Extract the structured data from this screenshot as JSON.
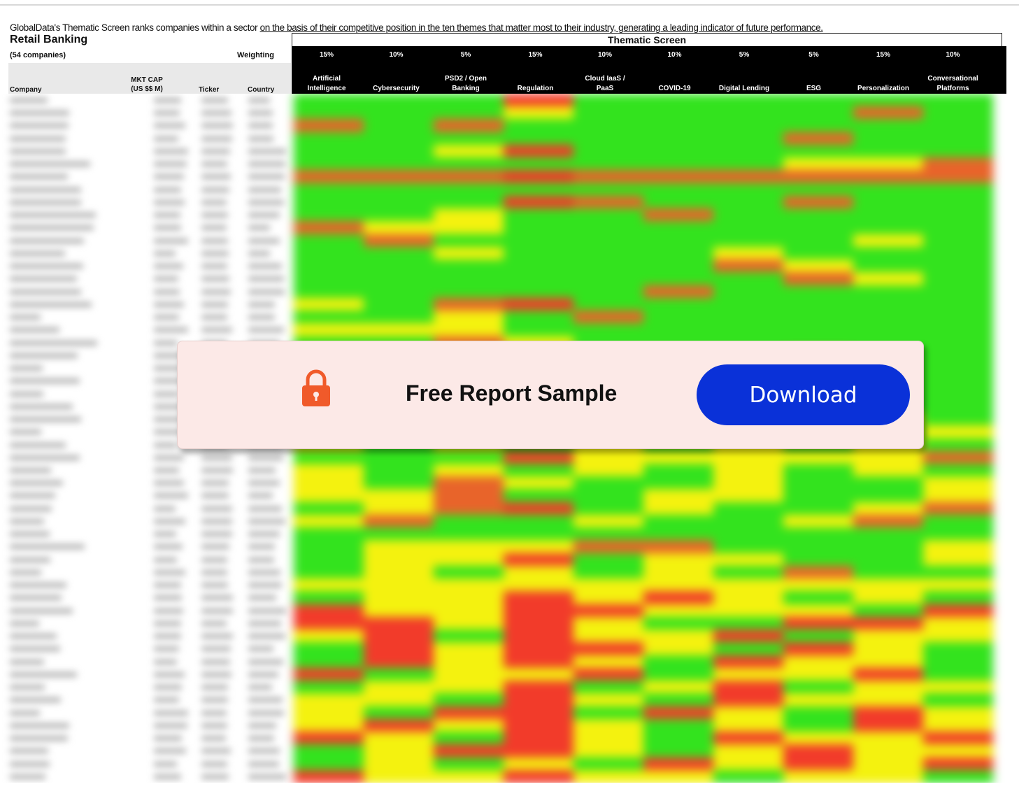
{
  "intro": {
    "text_a": "GlobalData's Thematic Screen ranks companies within a sector ",
    "text_b": "on the basis of their competitive position in the  ten themes that matter most to their industry, generating a leading indicator of future performance."
  },
  "sector_title": "Retail Banking",
  "company_count": "(54 companies)",
  "weighting_label": "Weighting",
  "screen_title": "Thematic Screen",
  "columns": {
    "company": "Company",
    "mkt_cap_1": "MKT CAP",
    "mkt_cap_2": "(US $$ M)",
    "ticker": "Ticker",
    "country": "Country"
  },
  "themes": [
    {
      "weight": "15%",
      "name_1": "Artificial",
      "name_2": "Intelligence"
    },
    {
      "weight": "10%",
      "name_1": "",
      "name_2": "Cybersecurity"
    },
    {
      "weight": "5%",
      "name_1": "PSD2 / Open",
      "name_2": "Banking"
    },
    {
      "weight": "15%",
      "name_1": "",
      "name_2": "Regulation"
    },
    {
      "weight": "10%",
      "name_1": "Cloud IaaS /",
      "name_2": "PaaS"
    },
    {
      "weight": "10%",
      "name_1": "",
      "name_2": "COVID-19"
    },
    {
      "weight": "5%",
      "name_1": "",
      "name_2": "Digital Lending"
    },
    {
      "weight": "5%",
      "name_1": "",
      "name_2": "ESG"
    },
    {
      "weight": "15%",
      "name_1": "",
      "name_2": "Personalization"
    },
    {
      "weight": "10%",
      "name_1": "Conversational",
      "name_2": "Platforms"
    }
  ],
  "heat_colors": {
    "green": "#33e31e",
    "yellow": "#f4f20f",
    "red": "#f23b2a",
    "orange": "#e8642a"
  },
  "overlay": {
    "title": "Free Report Sample",
    "button": "Download",
    "icon": "padlock-icon",
    "accent": "#0a31d8",
    "lock_color": "#f05a2a"
  }
}
